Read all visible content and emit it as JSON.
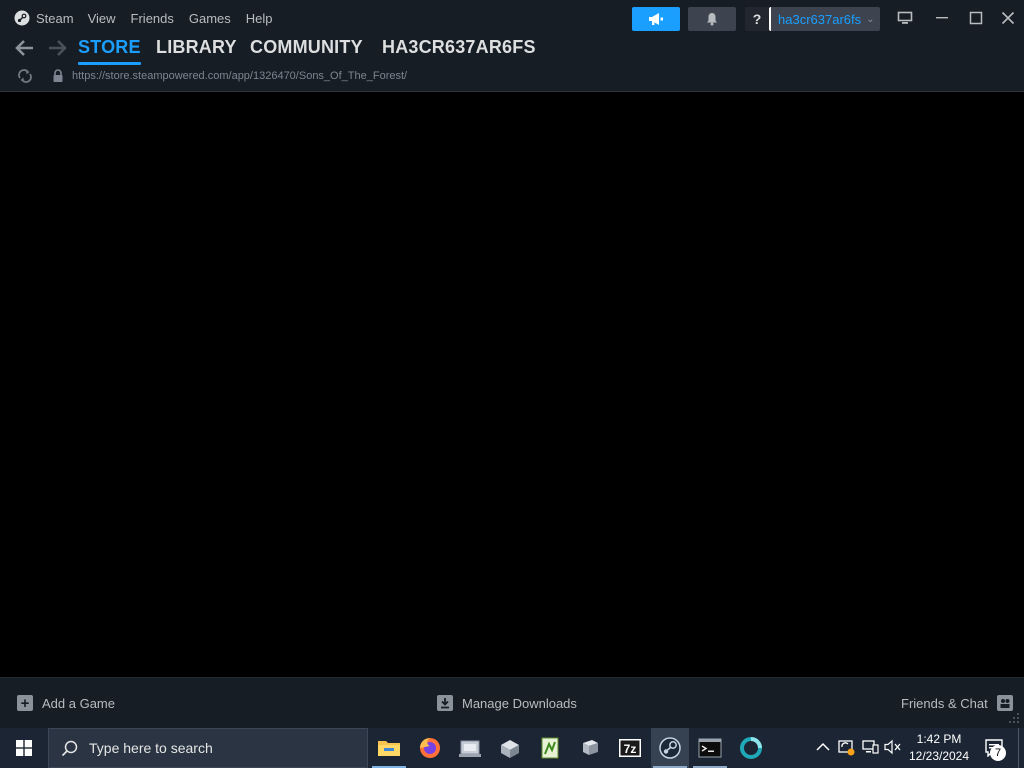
{
  "menubar": {
    "items": [
      "Steam",
      "View",
      "Friends",
      "Games",
      "Help"
    ]
  },
  "account": {
    "help_label": "?",
    "username": "ha3cr637ar6fs",
    "chevron": "⌄"
  },
  "nav": {
    "tabs": [
      "STORE",
      "LIBRARY",
      "COMMUNITY",
      "HA3CR637AR6FS"
    ],
    "active_tab": "STORE",
    "url": "https://store.steampowered.com/app/1326470/Sons_Of_The_Forest/"
  },
  "bottombar": {
    "add_game": "Add a Game",
    "manage_downloads": "Manage Downloads",
    "friends_chat": "Friends & Chat"
  },
  "taskbar": {
    "search_placeholder": "Type here to search",
    "apps": [
      "file-explorer",
      "firefox",
      "app-grey",
      "app-box",
      "notepad-plus",
      "app-drive",
      "7zip",
      "steam",
      "terminal",
      "teal-ring"
    ],
    "time": "1:42 PM",
    "date": "12/23/2024",
    "notification_count": "7"
  },
  "colors": {
    "accent": "#1a9fff",
    "chrome_bg": "#171d25",
    "taskbar_bg": "#1b2533"
  }
}
